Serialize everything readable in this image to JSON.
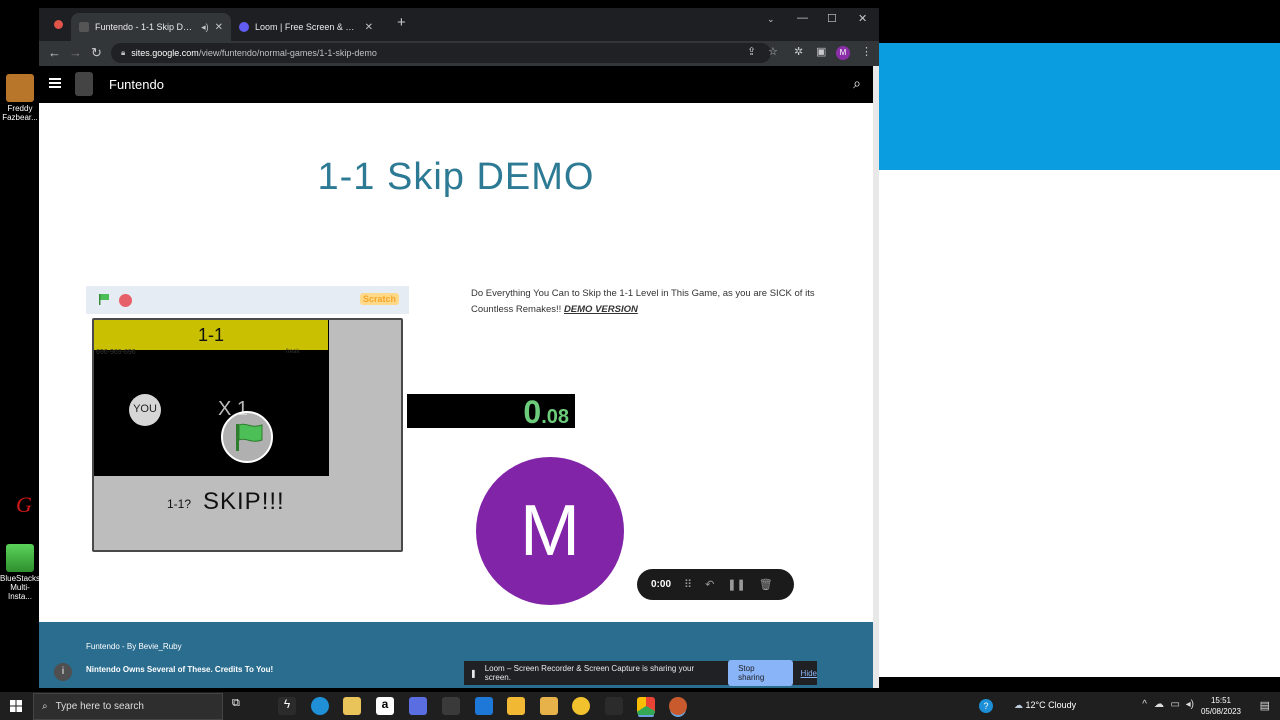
{
  "desktop": {
    "icons": [
      {
        "label": "Freddy Fazbear..."
      },
      {
        "label": "BlueStacks Multi-Insta..."
      }
    ],
    "partial_text": "G"
  },
  "browser": {
    "tabs": [
      {
        "title": "Funtendo - 1-1 Skip DEMO",
        "active": true
      },
      {
        "title": "Loom | Free Screen & Video Rec",
        "active": false
      }
    ],
    "url_domain": "sites.google.com",
    "url_path": "/view/funtendo/normal-games/1-1-skip-demo",
    "profile_initial": "M"
  },
  "site": {
    "name": "Funtendo",
    "page_title": "1-1 Skip DEMO",
    "description": "Do Everything You Can to Skip the 1-1 Level in This Game, as you are SICK of its Countless Remakes!!",
    "description_demo": "DEMO VERSION",
    "footer_line1": "Funtendo - By Bevie_Ruby",
    "footer_line2": "Nintendo Owns Several of These. Credits To You!"
  },
  "game": {
    "scratch_logo": "Scratch",
    "level_banner": "1-1",
    "code": "696-969-696",
    "freak": "freak",
    "you_label": "YOU",
    "lives": "X 1",
    "question": "1-1?",
    "skip": "SKIP!!!",
    "timer_big": "0",
    "timer_small": ".08"
  },
  "loom": {
    "camera_initial": "M",
    "elapsed": "0:00",
    "share_message": "Loom – Screen Recorder & Screen Capture is sharing your screen.",
    "stop_label": "Stop sharing",
    "hide_label": "Hide"
  },
  "taskbar": {
    "search_placeholder": "Type here to search",
    "weather": "12°C  Cloudy",
    "time": "15:51",
    "date": "05/08/2023"
  },
  "colors": {
    "title_teal": "#2d7a94",
    "footer_blue": "#2a6d8f",
    "camera_purple": "#8224a8",
    "timer_green": "#6dcc7b"
  }
}
